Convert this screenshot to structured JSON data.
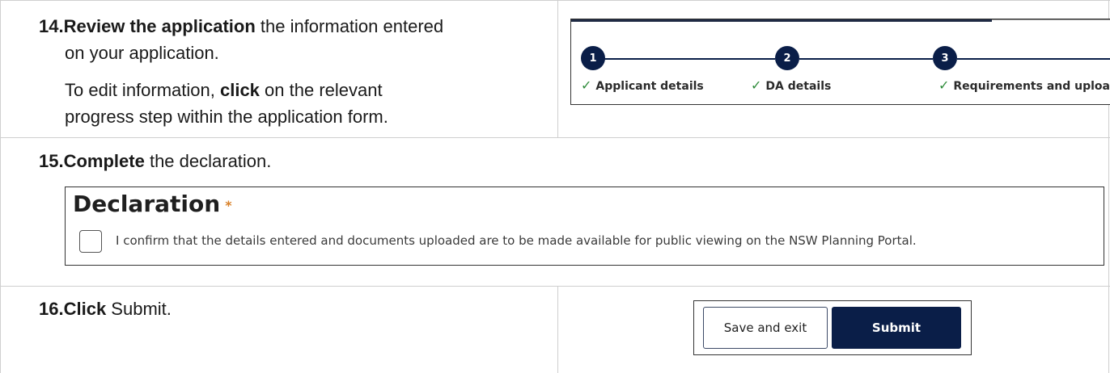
{
  "steps": {
    "step14": {
      "number": "14.",
      "bold": "Review the application",
      "rest": " the information entered",
      "line2": "on your application.",
      "line3_pre": "To edit information, ",
      "line3_bold": "click",
      "line3_post": " on the relevant",
      "line4": "progress step within the application form."
    },
    "step15": {
      "number": "15.",
      "bold": "Complete",
      "rest": " the declaration."
    },
    "step16": {
      "number": "16.",
      "bold": "Click",
      "rest": " Submit."
    }
  },
  "progress": {
    "items": [
      {
        "num": "1",
        "label": "Applicant details"
      },
      {
        "num": "2",
        "label": "DA details"
      },
      {
        "num": "3",
        "label": "Requirements and uploa"
      }
    ],
    "check_glyph": "✓"
  },
  "declaration": {
    "title": "Declaration",
    "required_mark": "*",
    "text": "I confirm that the details entered and documents uploaded are to be made available for public viewing on the NSW Planning Portal."
  },
  "buttons": {
    "save_exit": "Save and exit",
    "submit": "Submit"
  },
  "colors": {
    "accent": "#0a1e48",
    "check": "#2e8b3a",
    "required": "#d9822b"
  }
}
